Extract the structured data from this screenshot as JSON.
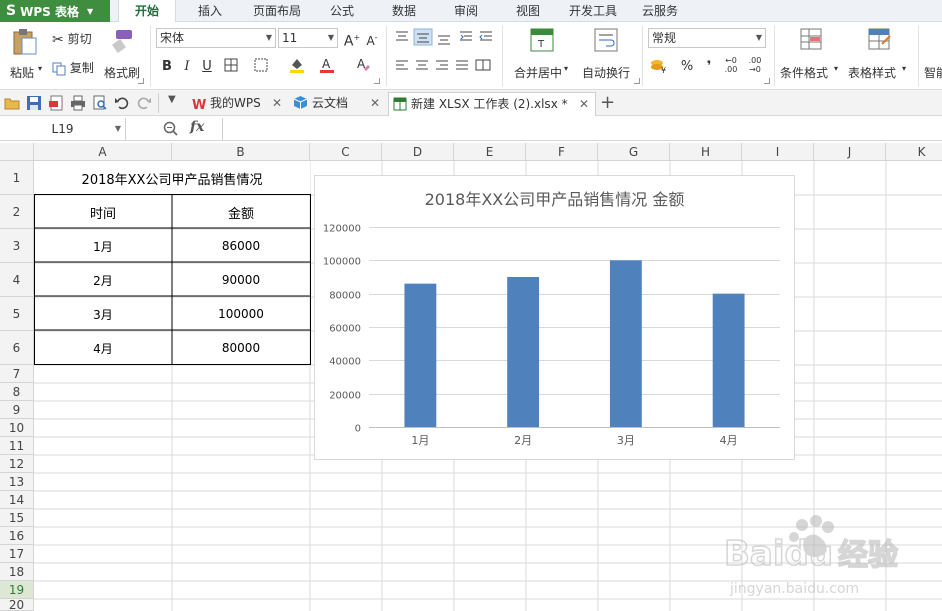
{
  "app": {
    "logo": "WPS 表格"
  },
  "menu_tabs": [
    "开始",
    "插入",
    "页面布局",
    "公式",
    "数据",
    "审阅",
    "视图",
    "开发工具",
    "云服务"
  ],
  "ribbon": {
    "paste": "粘贴",
    "cut": "剪切",
    "copy": "复制",
    "format_painter": "格式刷",
    "font_name": "宋体",
    "font_size": "11",
    "bold": "B",
    "italic": "I",
    "underline": "U",
    "merge_center": "合并居中",
    "wrap_text": "自动换行",
    "number_format": "常规",
    "percent": "%",
    "comma": "❜",
    "cond_format": "条件格式",
    "table_style": "表格样式",
    "smart": "智能"
  },
  "doc_tabs": [
    {
      "label": "我的WPS"
    },
    {
      "label": "云文档"
    },
    {
      "label": "新建 XLSX 工作表 (2).xlsx *"
    }
  ],
  "formula_bar": {
    "name_box": "L19",
    "fx": "fx",
    "content": ""
  },
  "columns": [
    "A",
    "B",
    "C",
    "D",
    "E",
    "F",
    "G",
    "H",
    "I",
    "J",
    "K"
  ],
  "rows": [
    "1",
    "2",
    "3",
    "4",
    "5",
    "6",
    "7",
    "8",
    "9",
    "10",
    "11",
    "12",
    "13",
    "14",
    "15",
    "16",
    "17",
    "18",
    "19",
    "20"
  ],
  "selected_row": "19",
  "table": {
    "title": "2018年XX公司甲产品销售情况",
    "headers": [
      "时间",
      "金额"
    ],
    "rows": [
      [
        "1月",
        "86000"
      ],
      [
        "2月",
        "90000"
      ],
      [
        "3月",
        "100000"
      ],
      [
        "4月",
        "80000"
      ]
    ]
  },
  "chart_data": {
    "type": "bar",
    "title": "2018年XX公司甲产品销售情况 金额",
    "categories": [
      "1月",
      "2月",
      "3月",
      "4月"
    ],
    "values": [
      86000,
      90000,
      100000,
      80000
    ],
    "ylim": [
      0,
      120000
    ],
    "yticks": [
      "0",
      "20000",
      "40000",
      "60000",
      "80000",
      "100000",
      "120000"
    ],
    "grid": true,
    "bar_color": "#4f81bd"
  },
  "watermark": {
    "brand": "Baidu",
    "cn": "经验",
    "url": "jingyan.baidu.com"
  }
}
